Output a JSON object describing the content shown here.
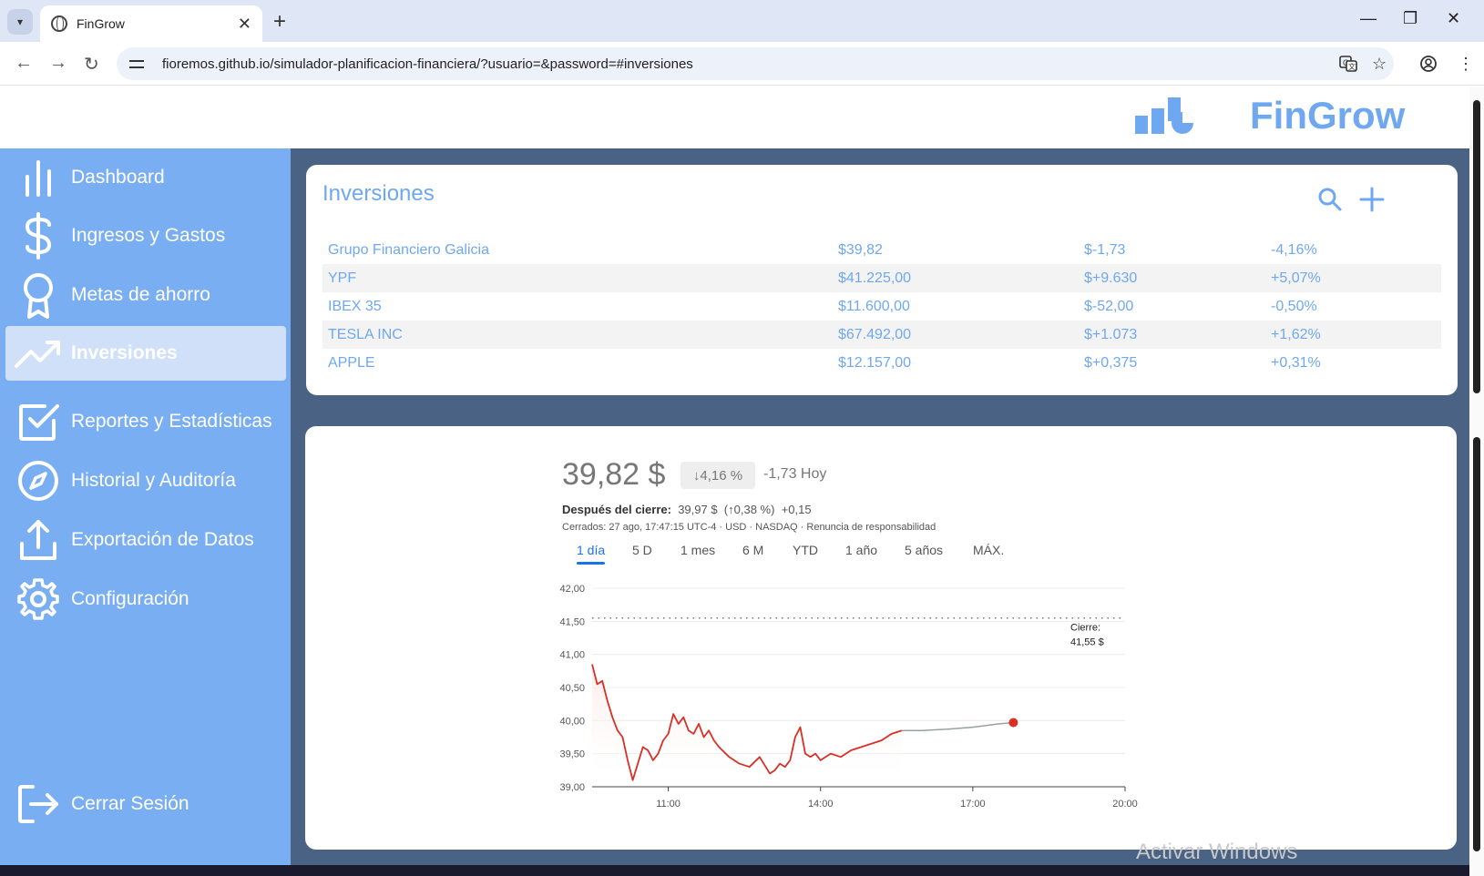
{
  "browser": {
    "tab_title": "FinGrow",
    "url": "fioremos.github.io/simulador-planificacion-financiera/?usuario=&password=#inversiones"
  },
  "app": {
    "brand": "FinGrow"
  },
  "sidebar": {
    "items": [
      {
        "label": "Dashboard",
        "icon": "bar-chart-icon"
      },
      {
        "label": "Ingresos y Gastos",
        "icon": "dollar-icon"
      },
      {
        "label": "Metas de ahorro",
        "icon": "award-icon"
      },
      {
        "label": "Inversiones",
        "icon": "trending-up-icon",
        "active": true
      },
      {
        "label": "Reportes y Estadísticas",
        "icon": "check-square-icon"
      },
      {
        "label": "Historial y Auditoría",
        "icon": "compass-icon"
      },
      {
        "label": "Exportación de Datos",
        "icon": "upload-icon"
      },
      {
        "label": "Configuración",
        "icon": "gear-icon"
      }
    ],
    "logout": "Cerrar Sesión"
  },
  "investments": {
    "title": "Inversiones",
    "rows": [
      {
        "name": "Grupo Financiero Galicia",
        "price": "$39,82",
        "change": "$-1,73",
        "pct": "-4,16%"
      },
      {
        "name": "YPF",
        "price": "$41.225,00",
        "change": "$+9.630",
        "pct": "+5,07%"
      },
      {
        "name": "IBEX 35",
        "price": "$11.600,00",
        "change": "$-52,00",
        "pct": "-0,50%"
      },
      {
        "name": "TESLA INC",
        "price": "$67.492,00",
        "change": "$+1.073",
        "pct": "+1,62%"
      },
      {
        "name": "APPLE",
        "price": "$12.157,00",
        "change": "$+0,375",
        "pct": "+0,31%"
      }
    ]
  },
  "quote": {
    "price": "39,82 $",
    "change_pct": "↓4,16 %",
    "change_today": "-1,73 Hoy",
    "after_label": "Después del cierre:",
    "after_value": "39,97 $",
    "after_pct": "(↑0,38 %)",
    "after_change": "+0,15",
    "closed_info": "Cerrados: 27 ago, 17:47:15 UTC-4 · USD · NASDAQ · Renuncia de responsabilidad",
    "ranges": [
      "1 día",
      "5 D",
      "1 mes",
      "6 M",
      "YTD",
      "1 año",
      "5 años",
      "MÁX."
    ],
    "active_range": "1 día"
  },
  "chart_data": {
    "type": "line",
    "x_ticks": [
      "11:00",
      "14:00",
      "17:00",
      "20:00"
    ],
    "y_ticks": [
      "42,00",
      "41,50",
      "41,00",
      "40,50",
      "40,00",
      "39,50",
      "39,00"
    ],
    "ylim": [
      39,
      42
    ],
    "reference_line": {
      "value": 41.55,
      "label": "Cierre:",
      "value_label": "41,55 $"
    },
    "series": [
      {
        "color": "#d93025",
        "x_hours": [
          9.5,
          9.6,
          9.7,
          9.8,
          9.9,
          10.0,
          10.1,
          10.2,
          10.3,
          10.4,
          10.5,
          10.6,
          10.7,
          10.8,
          10.9,
          11.0,
          11.1,
          11.2,
          11.3,
          11.4,
          11.5,
          11.6,
          11.7,
          11.8,
          11.9,
          12.0,
          12.2,
          12.4,
          12.6,
          12.8,
          13.0,
          13.1,
          13.2,
          13.3,
          13.4,
          13.5,
          13.6,
          13.7,
          13.8,
          13.9,
          14.0,
          14.2,
          14.4,
          14.6,
          14.8,
          15.0,
          15.2,
          15.4,
          15.6
        ],
        "values": [
          40.85,
          40.55,
          40.6,
          40.3,
          40.05,
          39.85,
          39.75,
          39.4,
          39.1,
          39.35,
          39.6,
          39.55,
          39.4,
          39.5,
          39.7,
          39.8,
          40.1,
          39.95,
          40.05,
          39.85,
          39.8,
          39.95,
          39.75,
          39.85,
          39.7,
          39.6,
          39.45,
          39.35,
          39.3,
          39.45,
          39.2,
          39.25,
          39.35,
          39.3,
          39.4,
          39.75,
          39.9,
          39.5,
          39.45,
          39.5,
          39.4,
          39.5,
          39.45,
          39.55,
          39.6,
          39.65,
          39.7,
          39.8,
          39.85
        ]
      },
      {
        "color": "#9aa0a6",
        "x_hours": [
          15.6,
          16.0,
          16.5,
          17.0,
          17.5,
          17.8
        ],
        "values": [
          39.85,
          39.85,
          39.87,
          39.9,
          39.95,
          39.97
        ]
      }
    ],
    "end_marker": {
      "x_hours": 17.8,
      "value": 39.97
    }
  }
}
